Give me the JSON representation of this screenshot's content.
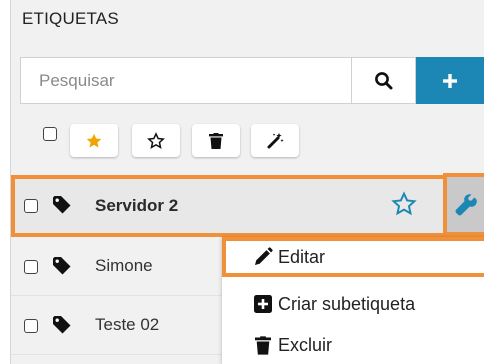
{
  "panel": {
    "title": "ETIQUETAS",
    "search": {
      "placeholder": "Pesquisar",
      "value": ""
    },
    "toolbar": {
      "icons": [
        "star-filled-icon",
        "star-outline-icon",
        "trash-icon",
        "magic-wand-icon"
      ]
    }
  },
  "tags": [
    {
      "label": "Servidor 2",
      "selected": true,
      "starred": false
    },
    {
      "label": "Simone",
      "selected": false
    },
    {
      "label": "Teste 02",
      "selected": false
    }
  ],
  "context_menu": {
    "items": [
      {
        "label": "Editar",
        "icon": "pencil-icon"
      },
      {
        "label": "Criar subetiqueta",
        "icon": "plus-square-icon"
      },
      {
        "label": "Excluir",
        "icon": "trash-icon"
      }
    ]
  },
  "colors": {
    "accent": "#1c87b4",
    "highlight": "#f0913a",
    "star": "#f0a500",
    "star_outline_selected": "#1c87b4"
  }
}
